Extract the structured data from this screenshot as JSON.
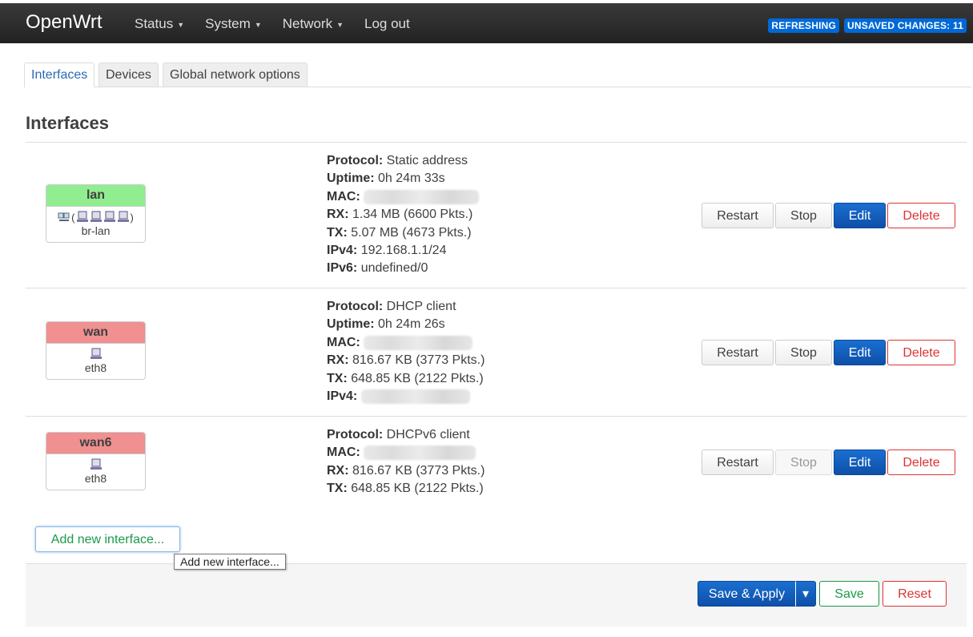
{
  "nav": {
    "brand": "OpenWrt",
    "menu": [
      {
        "label": "Status",
        "dropdown": true
      },
      {
        "label": "System",
        "dropdown": true
      },
      {
        "label": "Network",
        "dropdown": true
      },
      {
        "label": "Log out",
        "dropdown": false
      }
    ],
    "badges": {
      "refreshing": "REFRESHING",
      "unsaved": "UNSAVED CHANGES: 11"
    }
  },
  "tabs": [
    "Interfaces",
    "Devices",
    "Global network options"
  ],
  "page_title": "Interfaces",
  "interfaces": [
    {
      "name": "lan",
      "status_color": "green",
      "device": "br-lan",
      "bridge_ports": 4,
      "info": {
        "protocol_label": "Protocol:",
        "protocol": "Static address",
        "uptime_label": "Uptime:",
        "uptime": "0h 24m 33s",
        "mac_label": "MAC:",
        "rx_label": "RX:",
        "rx": "1.34 MB (6600 Pkts.)",
        "tx_label": "TX:",
        "tx": "5.07 MB (4673 Pkts.)",
        "ipv4_label": "IPv4:",
        "ipv4": "192.168.1.1/24",
        "ipv6_label": "IPv6:",
        "ipv6": "undefined/0"
      },
      "stop_enabled": true
    },
    {
      "name": "wan",
      "status_color": "red",
      "device": "eth8",
      "info": {
        "protocol_label": "Protocol:",
        "protocol": "DHCP client",
        "uptime_label": "Uptime:",
        "uptime": "0h 24m 26s",
        "mac_label": "MAC:",
        "rx_label": "RX:",
        "rx": "816.67 KB (3773 Pkts.)",
        "tx_label": "TX:",
        "tx": "648.85 KB (2122 Pkts.)",
        "ipv4_label": "IPv4:"
      },
      "stop_enabled": true
    },
    {
      "name": "wan6",
      "status_color": "red",
      "device": "eth8",
      "info": {
        "protocol_label": "Protocol:",
        "protocol": "DHCPv6 client",
        "mac_label": "MAC:",
        "rx_label": "RX:",
        "rx": "816.67 KB (3773 Pkts.)",
        "tx_label": "TX:",
        "tx": "648.85 KB (2122 Pkts.)"
      },
      "stop_enabled": false
    }
  ],
  "row_actions": {
    "restart": "Restart",
    "stop": "Stop",
    "edit": "Edit",
    "delete": "Delete"
  },
  "add_interface": {
    "label": "Add new interface...",
    "tooltip": "Add new interface..."
  },
  "footer": {
    "save_apply": "Save & Apply",
    "dropdown_caret": "▾",
    "save": "Save",
    "reset": "Reset"
  },
  "colors": {
    "primary": "#0e4fa8",
    "danger": "#dd3333",
    "success": "#1a9a4a",
    "link": "#2a6ab3",
    "up": "#90ee90",
    "down": "#f09090"
  }
}
